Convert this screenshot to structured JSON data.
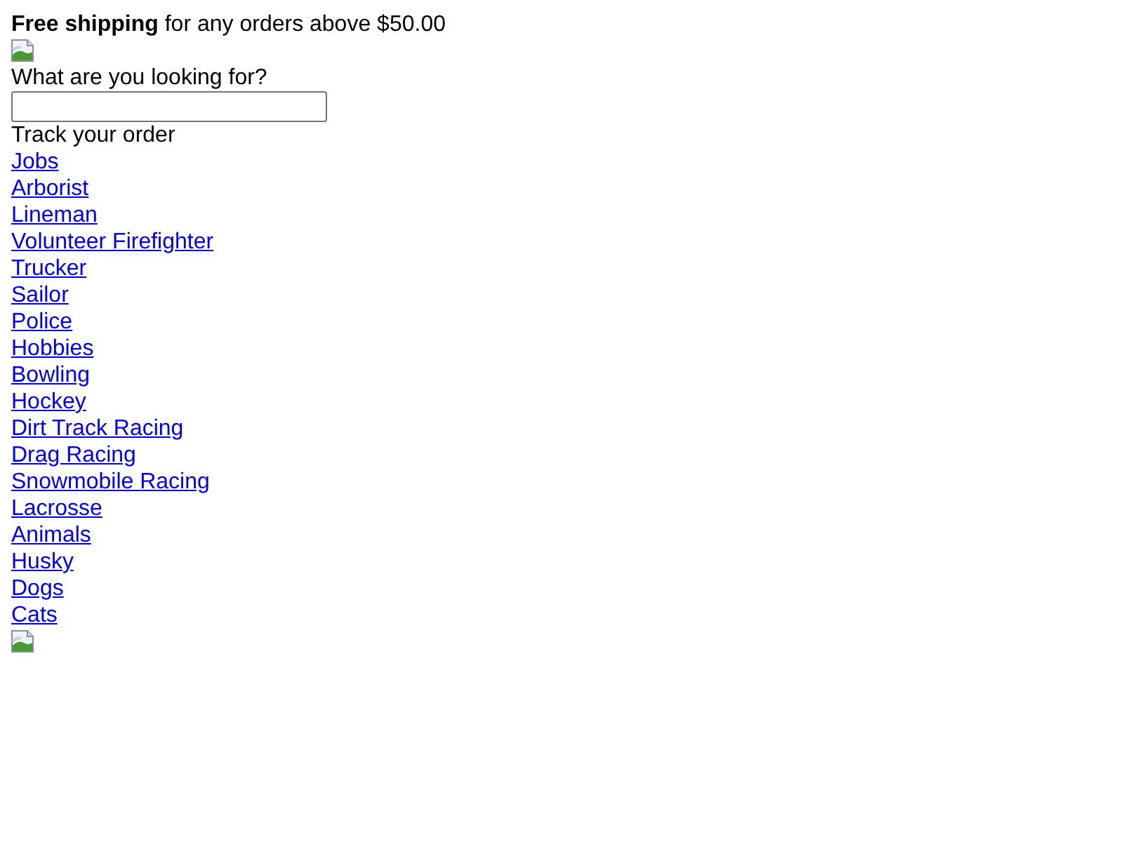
{
  "banner": {
    "text": "**Free shipping** for any orders above $50.00"
  },
  "search": {
    "label": "What are you looking for?"
  },
  "track_order": {
    "text": "Track your order"
  },
  "links": [
    "Jobs",
    "Arborist",
    "Lineman",
    "Volunteer Firefighter",
    "Trucker",
    "Sailor",
    "Police",
    "Hobbies",
    "Bowling",
    "Hockey",
    "Dirt Track Racing",
    "Drag Racing",
    "Snowmobile Racing",
    "Lacrosse",
    "Animals",
    "Husky",
    "Dogs",
    "Cats"
  ]
}
